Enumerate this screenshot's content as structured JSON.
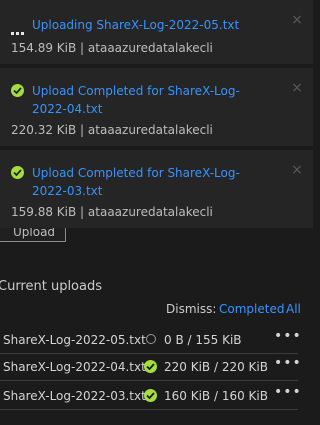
{
  "notifications": [
    {
      "title": "Uploading ShareX-Log-2022-05.txt",
      "meta": "154.89 KiB | ataaazuredatalakecli",
      "status_icon": "ellipsis-icon"
    },
    {
      "title": "Upload Completed for ShareX-Log-2022-04.txt",
      "meta": "220.32 KiB | ataaazuredatalakecli",
      "status_icon": "check-circle-icon"
    },
    {
      "title": "Upload Completed for ShareX-Log-2022-03.txt",
      "meta": "159.88 KiB | ataaazuredatalakecli",
      "status_icon": "check-circle-icon"
    }
  ],
  "upload_button": "Upload",
  "current_uploads": {
    "title": "Current uploads",
    "dismiss_label": "Dismiss:",
    "dismiss_completed": "Completed",
    "dismiss_all": "All",
    "rows": [
      {
        "name": "ShareX-Log-2022-05.txt",
        "progress": "0 B / 155 KiB",
        "status": "in-progress",
        "more": "•••"
      },
      {
        "name": "ShareX-Log-2022-04.txt",
        "progress": "220 KiB / 220 KiB",
        "status": "completed",
        "more": "•••"
      },
      {
        "name": "ShareX-Log-2022-03.txt",
        "progress": "160 KiB / 160 KiB",
        "status": "completed",
        "more": "•••"
      }
    ]
  },
  "colors": {
    "background": "#1b1b1b",
    "toast_background": "#252526",
    "link_blue": "#3794ff",
    "success_green": "#a3df3c"
  }
}
